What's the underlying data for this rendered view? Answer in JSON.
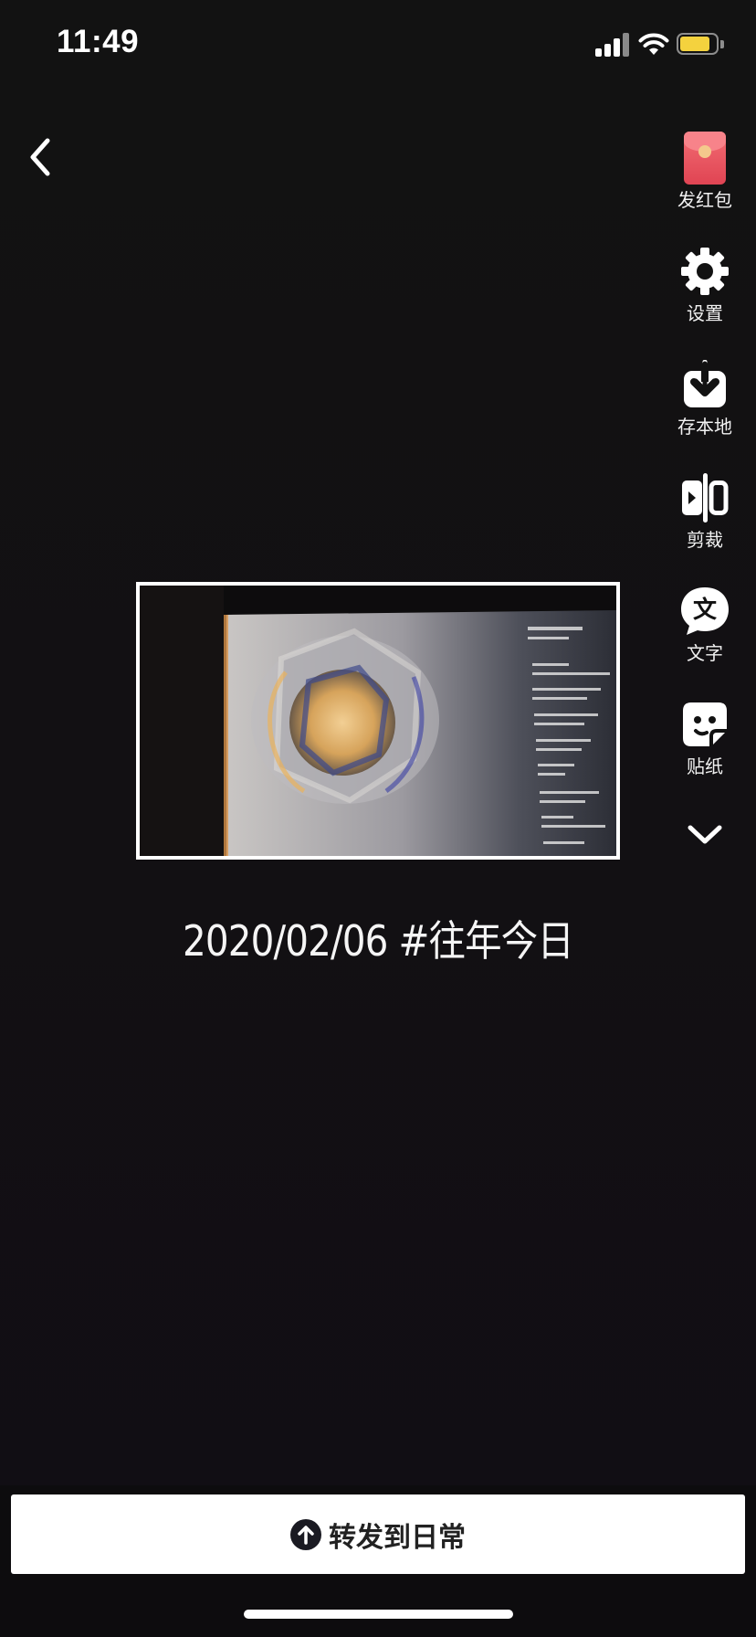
{
  "status_bar": {
    "time": "11:49",
    "battery_level": 0.85,
    "battery_color": "#f4d23e"
  },
  "navigation": {
    "back_icon": "chevron-left-icon"
  },
  "toolbar": {
    "items": [
      {
        "label": "发红包",
        "icon": "red-packet-icon"
      },
      {
        "label": "设置",
        "icon": "gear-icon"
      },
      {
        "label": "存本地",
        "icon": "download-icon"
      },
      {
        "label": "剪裁",
        "icon": "crop-icon"
      },
      {
        "label": "文字",
        "icon": "text-icon"
      },
      {
        "label": "贴纸",
        "icon": "sticker-icon"
      }
    ],
    "more_icon": "chevron-down-icon"
  },
  "post": {
    "caption": "2020/02/06  #往年今日"
  },
  "footer": {
    "forward_label": "转发到日常",
    "forward_icon": "arrow-up-circle-icon"
  }
}
